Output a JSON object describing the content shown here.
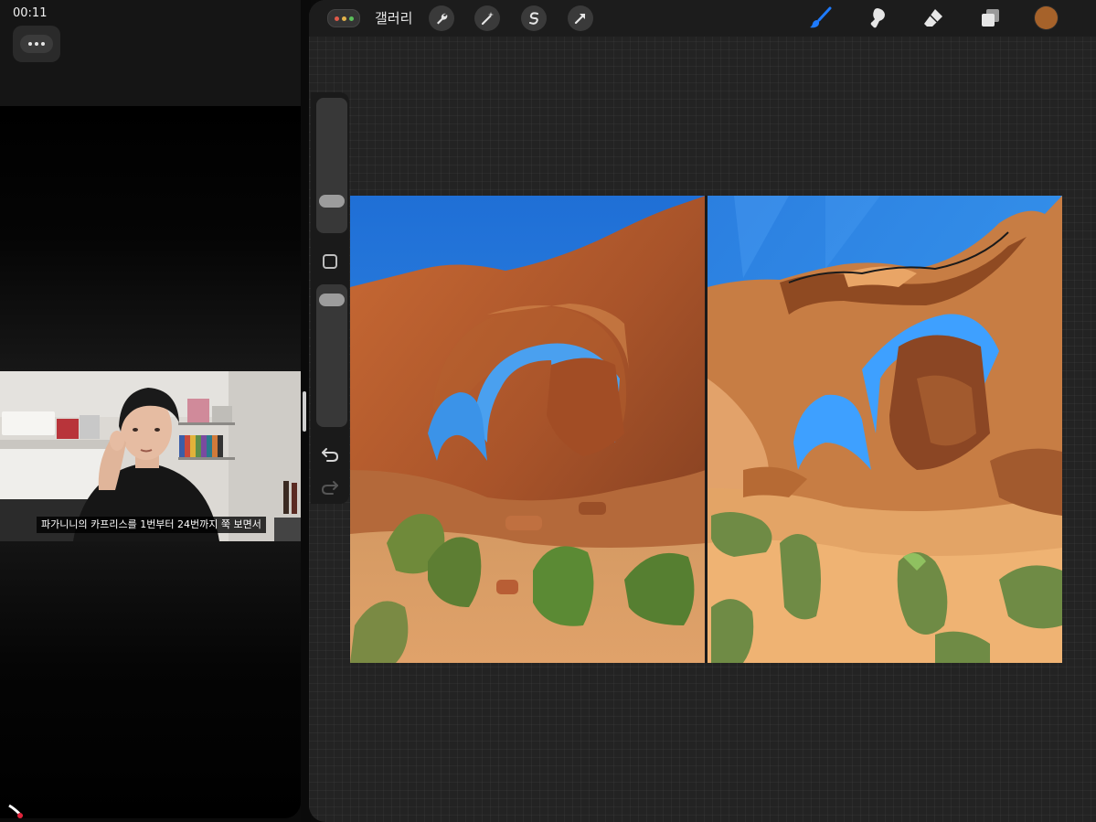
{
  "status": {
    "time": "00:11"
  },
  "video": {
    "caption": "파가니니의 카프리스를 1번부터 24번까지 쭉 보면서"
  },
  "procreate": {
    "gallery_label": "갤러리",
    "current_color": "#a6622a",
    "accent_color": "#1e7bff",
    "tools": [
      "wrench-icon",
      "magic-wand-icon",
      "selection-icon",
      "transform-arrow-icon"
    ],
    "right_tools": [
      "brush-icon",
      "smudge-icon",
      "eraser-icon",
      "layers-icon"
    ]
  }
}
